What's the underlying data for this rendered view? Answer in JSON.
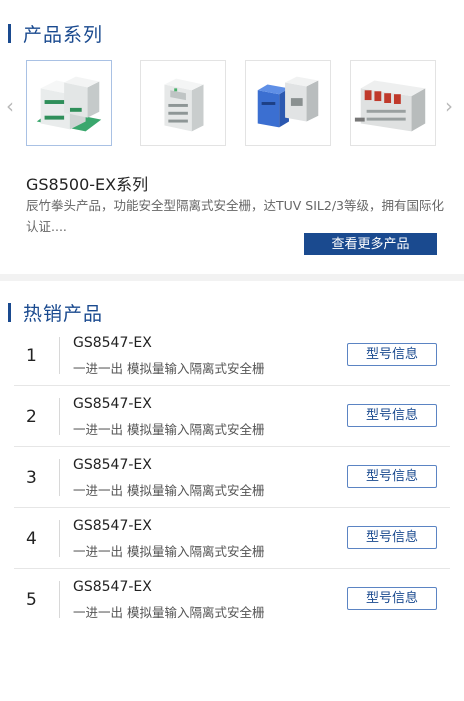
{
  "series_section": {
    "title": "产品系列",
    "prev_arrow": "‹",
    "next_arrow": "›",
    "thumbnails": [
      {
        "icon": "green-din-module-image",
        "active": true
      },
      {
        "icon": "gray-din-module-image",
        "active": false
      },
      {
        "icon": "blue-din-module-image",
        "active": false
      },
      {
        "icon": "io-rack-module-image",
        "active": false
      }
    ],
    "product_name": "GS8500-EX系列",
    "product_desc": "辰竹拳头产品，功能安全型隔离式安全栅，达TUV SIL2/3等级，拥有国际化认证....",
    "more_button": "查看更多产品"
  },
  "hot_section": {
    "title": "热销产品",
    "items": [
      {
        "rank": "1",
        "model": "GS8547-EX",
        "desc": "一进一出 模拟量输入隔离式安全栅",
        "button": "型号信息"
      },
      {
        "rank": "2",
        "model": "GS8547-EX",
        "desc": "一进一出 模拟量输入隔离式安全栅",
        "button": "型号信息"
      },
      {
        "rank": "3",
        "model": "GS8547-EX",
        "desc": "一进一出 模拟量输入隔离式安全栅",
        "button": "型号信息"
      },
      {
        "rank": "4",
        "model": "GS8547-EX",
        "desc": "一进一出 模拟量输入隔离式安全栅",
        "button": "型号信息"
      },
      {
        "rank": "5",
        "model": "GS8547-EX",
        "desc": "一进一出 模拟量输入隔离式安全栅",
        "button": "型号信息"
      }
    ]
  },
  "colors": {
    "brand": "#1a4a8f",
    "button_border": "#5b84c3"
  }
}
